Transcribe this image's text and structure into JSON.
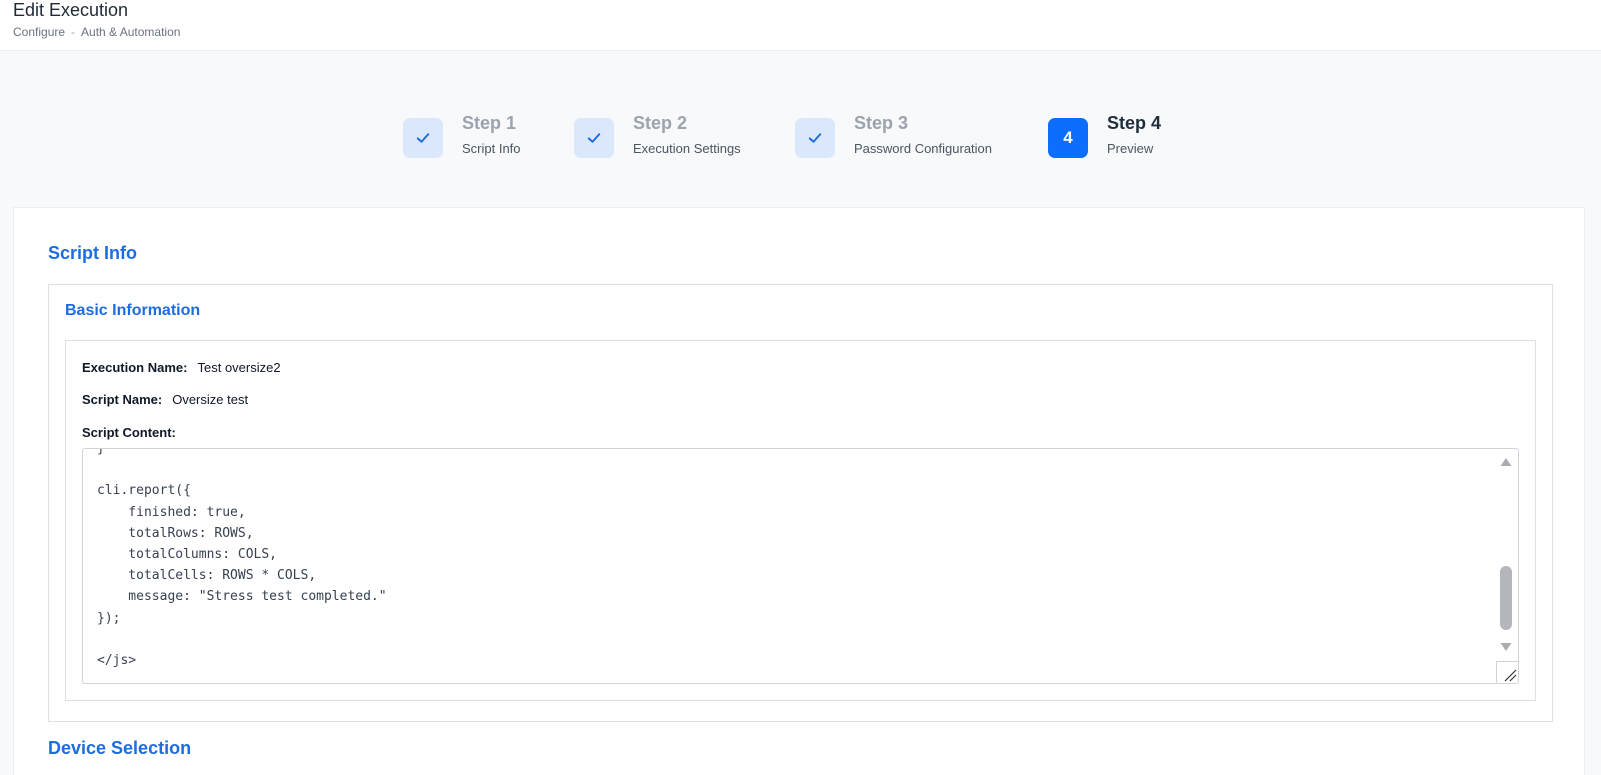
{
  "header": {
    "title": "Edit Execution",
    "breadcrumb": [
      "Configure",
      "Auth & Automation"
    ],
    "breadcrumb_separator": "-"
  },
  "stepper": {
    "steps": [
      {
        "title": "Step 1",
        "subtitle": "Script Info",
        "status": "complete",
        "icon": "check-icon"
      },
      {
        "title": "Step 2",
        "subtitle": "Execution Settings",
        "status": "complete",
        "icon": "check-icon"
      },
      {
        "title": "Step 3",
        "subtitle": "Password Configuration",
        "status": "complete",
        "icon": "check-icon"
      },
      {
        "title": "Step 4",
        "subtitle": "Preview",
        "status": "active",
        "number": "4"
      }
    ]
  },
  "script_info": {
    "section_title": "Script Info",
    "basic_information": {
      "title": "Basic Information",
      "execution_name_label": "Execution Name:",
      "execution_name_value": "Test oversize2",
      "script_name_label": "Script Name:",
      "script_name_value": "Oversize test",
      "script_content_label": "Script Content:",
      "script_content_visible": "}\n\ncli.report({\n    finished: true,\n    totalRows: ROWS,\n    totalColumns: COLS,\n    totalCells: ROWS * COLS,\n    message: \"Stress test completed.\"\n});\n\n</js>"
    }
  },
  "device_selection": {
    "section_title": "Device Selection"
  },
  "colors": {
    "accent": "#1d6ce0",
    "active_step": "#0d6efd",
    "complete_step_bg": "#dbe7fb"
  }
}
